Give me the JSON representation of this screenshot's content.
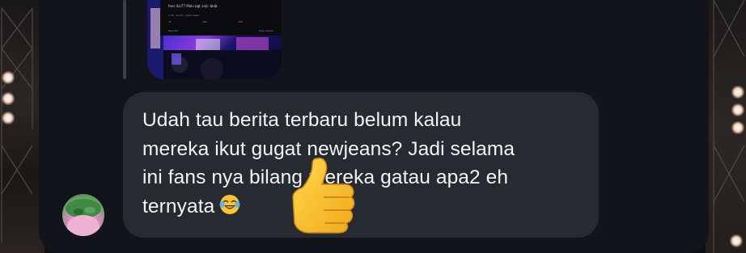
{
  "message": {
    "lines": [
      "Udah tau berita terbaru belum kalau",
      "mereka ikut gugat newjeans? Jadi selama",
      "ini fans nya bilang mereka gatau apa2 eh",
      "ternyata"
    ],
    "trailing_emoji": "face-with-tears-of-joy-icon"
  },
  "reaction": {
    "icon": "thumbs-up-icon"
  },
  "shared_post": {
    "text": "fans ILLIT? Malu bgt anjir 😂😂",
    "meta": "1:00 · 01/10 · 103K Views",
    "actions": [
      "41",
      "209",
      "450",
      ""
    ],
    "footer_left": "Reposts",
    "footer_right": "View quotes"
  },
  "colors": {
    "panel": "#11151b",
    "bubble": "#262a31",
    "text": "#f2f3f5"
  }
}
